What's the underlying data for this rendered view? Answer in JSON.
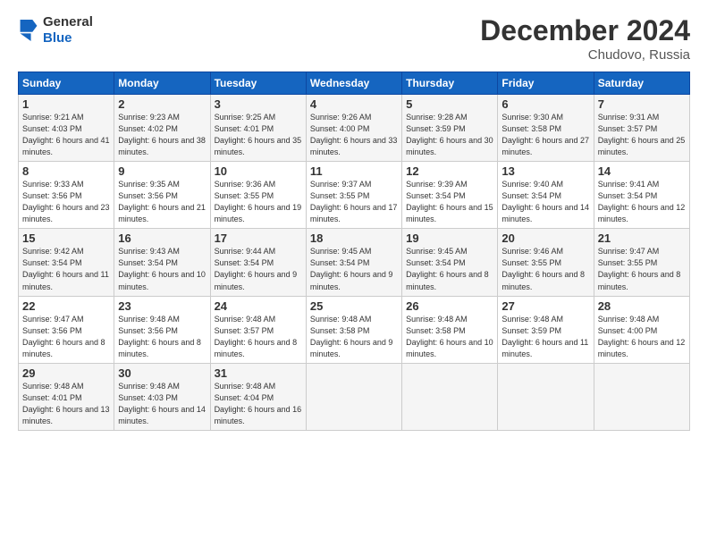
{
  "logo": {
    "line1": "General",
    "line2": "Blue"
  },
  "title": "December 2024",
  "location": "Chudovo, Russia",
  "days_header": [
    "Sunday",
    "Monday",
    "Tuesday",
    "Wednesday",
    "Thursday",
    "Friday",
    "Saturday"
  ],
  "weeks": [
    [
      {
        "day": "1",
        "sunrise": "9:21 AM",
        "sunset": "4:03 PM",
        "daylight": "6 hours and 41 minutes."
      },
      {
        "day": "2",
        "sunrise": "9:23 AM",
        "sunset": "4:02 PM",
        "daylight": "6 hours and 38 minutes."
      },
      {
        "day": "3",
        "sunrise": "9:25 AM",
        "sunset": "4:01 PM",
        "daylight": "6 hours and 35 minutes."
      },
      {
        "day": "4",
        "sunrise": "9:26 AM",
        "sunset": "4:00 PM",
        "daylight": "6 hours and 33 minutes."
      },
      {
        "day": "5",
        "sunrise": "9:28 AM",
        "sunset": "3:59 PM",
        "daylight": "6 hours and 30 minutes."
      },
      {
        "day": "6",
        "sunrise": "9:30 AM",
        "sunset": "3:58 PM",
        "daylight": "6 hours and 27 minutes."
      },
      {
        "day": "7",
        "sunrise": "9:31 AM",
        "sunset": "3:57 PM",
        "daylight": "6 hours and 25 minutes."
      }
    ],
    [
      {
        "day": "8",
        "sunrise": "9:33 AM",
        "sunset": "3:56 PM",
        "daylight": "6 hours and 23 minutes."
      },
      {
        "day": "9",
        "sunrise": "9:35 AM",
        "sunset": "3:56 PM",
        "daylight": "6 hours and 21 minutes."
      },
      {
        "day": "10",
        "sunrise": "9:36 AM",
        "sunset": "3:55 PM",
        "daylight": "6 hours and 19 minutes."
      },
      {
        "day": "11",
        "sunrise": "9:37 AM",
        "sunset": "3:55 PM",
        "daylight": "6 hours and 17 minutes."
      },
      {
        "day": "12",
        "sunrise": "9:39 AM",
        "sunset": "3:54 PM",
        "daylight": "6 hours and 15 minutes."
      },
      {
        "day": "13",
        "sunrise": "9:40 AM",
        "sunset": "3:54 PM",
        "daylight": "6 hours and 14 minutes."
      },
      {
        "day": "14",
        "sunrise": "9:41 AM",
        "sunset": "3:54 PM",
        "daylight": "6 hours and 12 minutes."
      }
    ],
    [
      {
        "day": "15",
        "sunrise": "9:42 AM",
        "sunset": "3:54 PM",
        "daylight": "6 hours and 11 minutes."
      },
      {
        "day": "16",
        "sunrise": "9:43 AM",
        "sunset": "3:54 PM",
        "daylight": "6 hours and 10 minutes."
      },
      {
        "day": "17",
        "sunrise": "9:44 AM",
        "sunset": "3:54 PM",
        "daylight": "6 hours and 9 minutes."
      },
      {
        "day": "18",
        "sunrise": "9:45 AM",
        "sunset": "3:54 PM",
        "daylight": "6 hours and 9 minutes."
      },
      {
        "day": "19",
        "sunrise": "9:45 AM",
        "sunset": "3:54 PM",
        "daylight": "6 hours and 8 minutes."
      },
      {
        "day": "20",
        "sunrise": "9:46 AM",
        "sunset": "3:55 PM",
        "daylight": "6 hours and 8 minutes."
      },
      {
        "day": "21",
        "sunrise": "9:47 AM",
        "sunset": "3:55 PM",
        "daylight": "6 hours and 8 minutes."
      }
    ],
    [
      {
        "day": "22",
        "sunrise": "9:47 AM",
        "sunset": "3:56 PM",
        "daylight": "6 hours and 8 minutes."
      },
      {
        "day": "23",
        "sunrise": "9:48 AM",
        "sunset": "3:56 PM",
        "daylight": "6 hours and 8 minutes."
      },
      {
        "day": "24",
        "sunrise": "9:48 AM",
        "sunset": "3:57 PM",
        "daylight": "6 hours and 8 minutes."
      },
      {
        "day": "25",
        "sunrise": "9:48 AM",
        "sunset": "3:58 PM",
        "daylight": "6 hours and 9 minutes."
      },
      {
        "day": "26",
        "sunrise": "9:48 AM",
        "sunset": "3:58 PM",
        "daylight": "6 hours and 10 minutes."
      },
      {
        "day": "27",
        "sunrise": "9:48 AM",
        "sunset": "3:59 PM",
        "daylight": "6 hours and 11 minutes."
      },
      {
        "day": "28",
        "sunrise": "9:48 AM",
        "sunset": "4:00 PM",
        "daylight": "6 hours and 12 minutes."
      }
    ],
    [
      {
        "day": "29",
        "sunrise": "9:48 AM",
        "sunset": "4:01 PM",
        "daylight": "6 hours and 13 minutes."
      },
      {
        "day": "30",
        "sunrise": "9:48 AM",
        "sunset": "4:03 PM",
        "daylight": "6 hours and 14 minutes."
      },
      {
        "day": "31",
        "sunrise": "9:48 AM",
        "sunset": "4:04 PM",
        "daylight": "6 hours and 16 minutes."
      },
      null,
      null,
      null,
      null
    ]
  ]
}
